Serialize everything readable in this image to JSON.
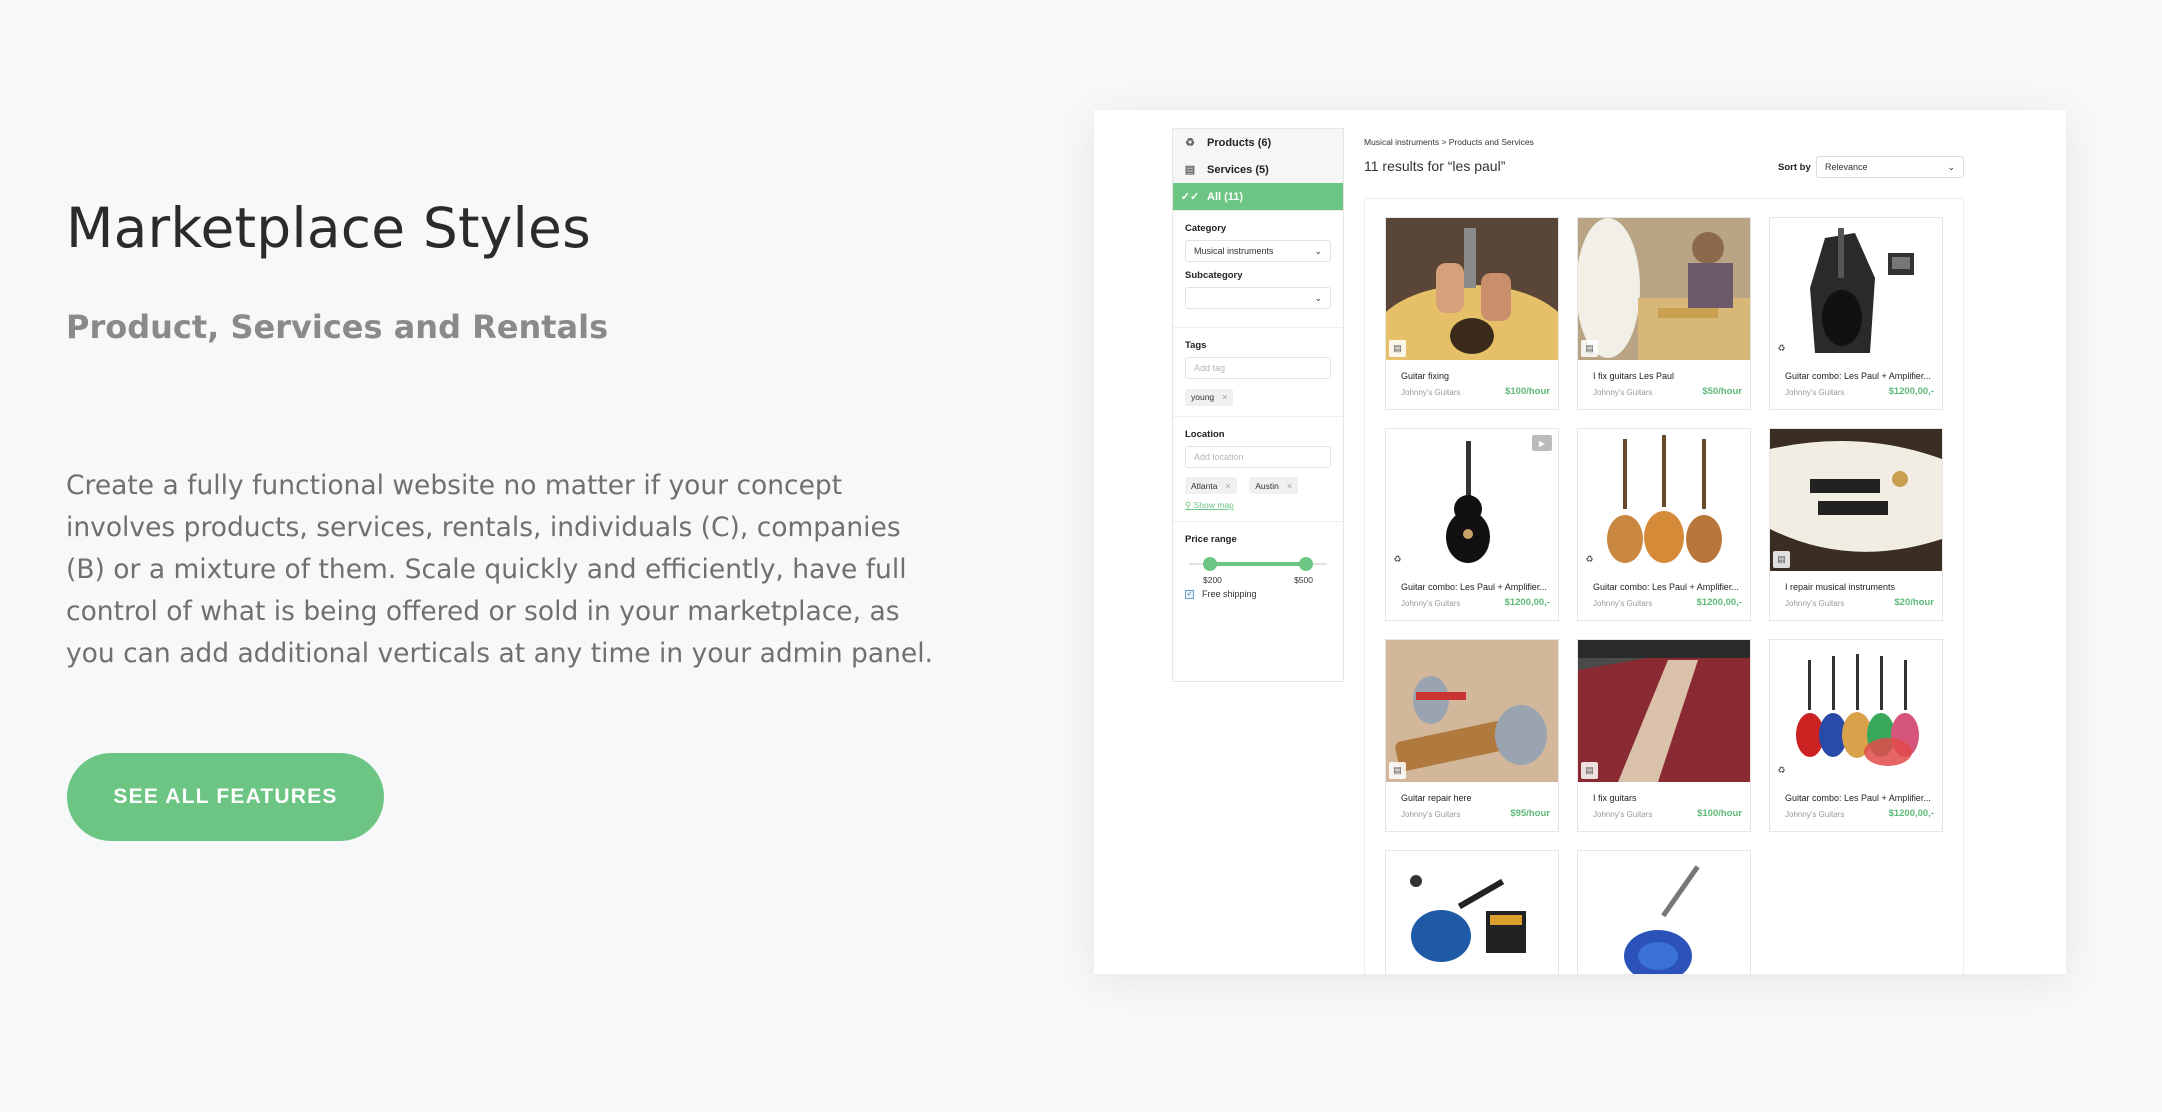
{
  "hero": {
    "title": "Marketplace Styles",
    "subtitle": "Product, Services and Rentals",
    "body": "Create a fully functional website no matter if your concept involves products, services, rentals, individuals (C), companies (B) or a mixture of them. Scale quickly and efficiently, have full control of what is being offered or sold in your marketplace, as you can add additional verticals at any time in your admin panel.",
    "cta_label": "SEE ALL FEATURES"
  },
  "colors": {
    "accent": "#6cc583",
    "price": "#5cb978",
    "background": "#f7f8fa"
  },
  "screenshot": {
    "sidebar": {
      "types": [
        {
          "label": "Products (6)",
          "icon": "product-icon",
          "active": false
        },
        {
          "label": "Services (5)",
          "icon": "briefcase-icon",
          "active": false
        },
        {
          "label": "All (11)",
          "icon": "double-check-icon",
          "active": true
        }
      ],
      "category_label": "Category",
      "category_value": "Musical instruments",
      "subcategory_label": "Subcategory",
      "subcategory_value": "",
      "tags_label": "Tags",
      "tags_placeholder": "Add tag",
      "tags": [
        "young"
      ],
      "location_label": "Location",
      "location_placeholder": "Add location",
      "locations": [
        "Atlanta",
        "Austin"
      ],
      "show_map": "Show map",
      "price_label": "Price range",
      "price_min": "$200",
      "price_max": "$500",
      "free_shipping": "Free shipping",
      "free_shipping_checked": true
    },
    "breadcrumb": "Musical instruments >  Products and Services",
    "results_text": "11 results for “les paul”",
    "sort_label": "Sort by",
    "sort_value": "Relevance",
    "items": [
      {
        "name": "Guitar fixing",
        "seller": "Johnny's Guitars",
        "price": "$100/hour",
        "kind": "service"
      },
      {
        "name": "I fix guitars Les Paul",
        "seller": "Johnny's Guitars",
        "price": "$50/hour",
        "kind": "service"
      },
      {
        "name": "Guitar combo: Les Paul + Amplifier...",
        "seller": "Johnny's Guitars",
        "price": "$1200,00,-",
        "kind": "product"
      },
      {
        "name": "Guitar combo: Les Paul + Amplifier...",
        "seller": "Johnny's Guitars",
        "price": "$1200,00,-",
        "kind": "product"
      },
      {
        "name": "Guitar combo: Les Paul + Amplifier...",
        "seller": "Johnny's Guitars",
        "price": "$1200,00,-",
        "kind": "product"
      },
      {
        "name": "I repair musical instruments",
        "seller": "Johnny's Guitars",
        "price": "$20/hour",
        "kind": "service"
      },
      {
        "name": "Guitar repair here",
        "seller": "Johnny's Guitars",
        "price": "$95/hour",
        "kind": "service"
      },
      {
        "name": "I fix guitars",
        "seller": "Johnny's Guitars",
        "price": "$100/hour",
        "kind": "service"
      },
      {
        "name": "Guitar combo: Les Paul + Amplifier...",
        "seller": "Johnny's Guitars",
        "price": "$1200,00,-",
        "kind": "product"
      },
      {
        "name": "",
        "seller": "",
        "price": "",
        "kind": "product"
      },
      {
        "name": "",
        "seller": "",
        "price": "",
        "kind": "product"
      }
    ]
  }
}
